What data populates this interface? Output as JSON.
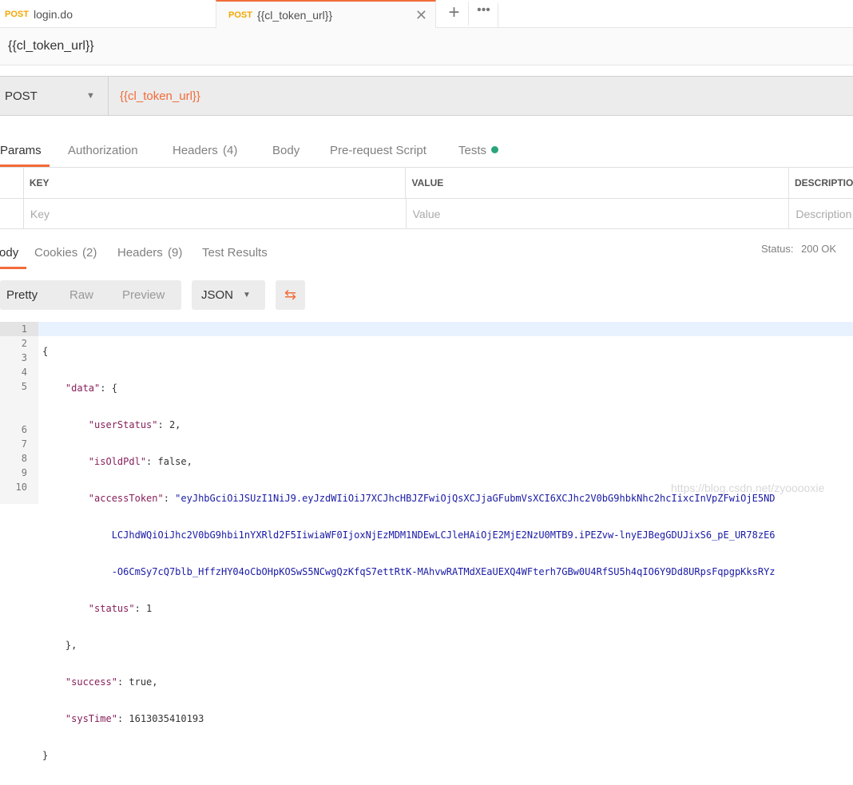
{
  "tabs": [
    {
      "method": "POST",
      "label": "login.do"
    },
    {
      "method": "POST",
      "label": "{{cl_token_url}}",
      "active": true
    }
  ],
  "title": "{{cl_token_url}}",
  "request": {
    "method": "POST",
    "url": "{{cl_token_url}}"
  },
  "request_tabs": [
    "Params",
    "Authorization",
    "Headers",
    "(4)",
    "Body",
    "Pre-request Script",
    "Tests"
  ],
  "params_table": {
    "headers": [
      "KEY",
      "VALUE",
      "DESCRIPTION"
    ],
    "placeholders": [
      "Key",
      "Value",
      "Description"
    ]
  },
  "response_tabs": [
    "Body",
    "Cookies",
    "(2)",
    "Headers",
    "(9)",
    "Test Results"
  ],
  "status": {
    "label": "Status:",
    "value": "200 OK"
  },
  "view_buttons": [
    "Pretty",
    "Raw",
    "Preview"
  ],
  "format": "JSON",
  "line_numbers": [
    "1",
    "2",
    "3",
    "4",
    "5",
    "",
    "",
    "6",
    "7",
    "8",
    "9",
    "10"
  ],
  "code": {
    "l1": "{",
    "l2k": "\"data\"",
    "l2": ": {",
    "l3k": "\"userStatus\"",
    "l3": ": 2,",
    "l4k": "\"isOldPdl\"",
    "l4": ": false,",
    "l5k": "\"accessToken\"",
    "l5": ": ",
    "l5v": "\"eyJhbGciOiJSUzI1NiJ9.eyJzdWIiOiJ7XCJhcHBJZFwiOjQsXCJjaGFubmVsXCI6XCJhc2V0bG9hbkNhc2hcIixcInVpZFwiOjE5ND",
    "l5b": "LCJhdWQiOiJhc2V0bG9hbi1nYXRld2F5IiwiaWF0IjoxNjEzMDM1NDEwLCJleHAiOjE2MjE2NzU0MTB9.iPEZvw-lnyEJBegGDUJixS6_pE_UR78zE6",
    "l5c": "-O6CmSy7cQ7blb_HffzHY04oCbOHpKOSwS5NCwgQzKfqS7ettRtK-MAhvwRATMdXEaUEXQ4WFterh7GBw0U4RfSU5h4qIO6Y9Dd8URpsFqpgpKksRYz",
    "l6k": "\"status\"",
    "l6": ": 1",
    "l7": "},",
    "l8k": "\"success\"",
    "l8": ": true,",
    "l9k": "\"sysTime\"",
    "l9": ": 1613035410193",
    "l10": "}"
  },
  "watermark": "https://blog.csdn.net/zyooooxie",
  "colors": {
    "accent": "#f26b3a",
    "method": "#f4a700",
    "status": "#2aa57a",
    "key": "#871f5a",
    "string": "#1a1aa6"
  }
}
